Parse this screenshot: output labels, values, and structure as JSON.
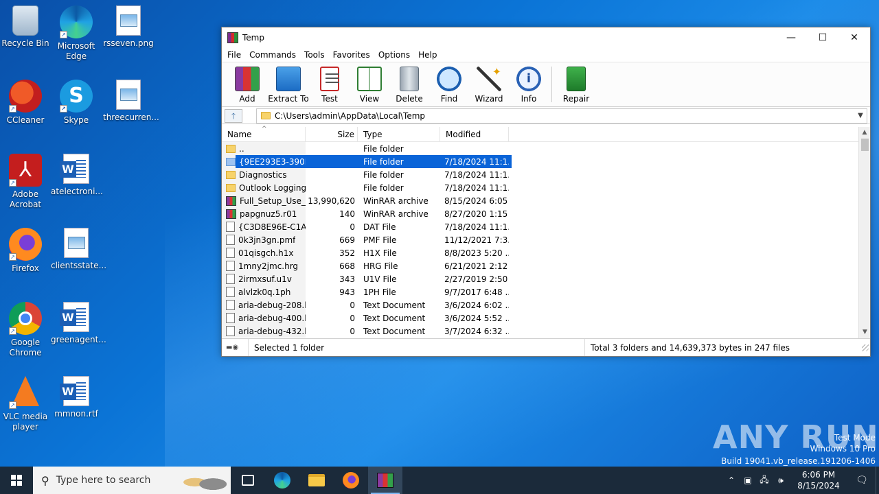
{
  "desktop": {
    "icons": [
      {
        "label": "Recycle Bin"
      },
      {
        "label": "Microsoft Edge"
      },
      {
        "label": "rsseven.png"
      },
      {
        "label": "CCleaner"
      },
      {
        "label": "Skype"
      },
      {
        "label": "threecurren..."
      },
      {
        "label": "Adobe Acrobat"
      },
      {
        "label": "atelectroni..."
      },
      {
        "label": "Firefox"
      },
      {
        "label": "clientsstate..."
      },
      {
        "label": "Google Chrome"
      },
      {
        "label": "greenagent..."
      },
      {
        "label": "VLC media player"
      },
      {
        "label": "mmnon.rtf"
      }
    ]
  },
  "window": {
    "title": "Temp",
    "controls": {
      "minimize": "—",
      "maximize": "☐",
      "close": "✕"
    },
    "menu": [
      "File",
      "Commands",
      "Tools",
      "Favorites",
      "Options",
      "Help"
    ],
    "toolbar": [
      {
        "label": "Add",
        "icon": "add-archive-icon"
      },
      {
        "label": "Extract To",
        "icon": "extract-icon"
      },
      {
        "label": "Test",
        "icon": "test-icon"
      },
      {
        "label": "View",
        "icon": "view-book-icon"
      },
      {
        "label": "Delete",
        "icon": "trash-icon"
      },
      {
        "label": "Find",
        "icon": "magnifier-icon"
      },
      {
        "label": "Wizard",
        "icon": "wand-icon"
      },
      {
        "label": "Info",
        "icon": "info-icon"
      },
      {
        "label": "Repair",
        "icon": "repair-icon"
      }
    ],
    "address": "C:\\Users\\admin\\AppData\\Local\\Temp",
    "columns": {
      "name": "Name",
      "size": "Size",
      "type": "Type",
      "modified": "Modified"
    },
    "files": [
      {
        "name": "..",
        "size": "",
        "type": "File folder",
        "modified": "",
        "icon": "folder"
      },
      {
        "name": "{9EE293E3-390D...",
        "size": "",
        "type": "File folder",
        "modified": "7/18/2024 11:1...",
        "icon": "folder",
        "selected": true
      },
      {
        "name": "Diagnostics",
        "size": "",
        "type": "File folder",
        "modified": "7/18/2024 11:1...",
        "icon": "folder"
      },
      {
        "name": "Outlook Logging",
        "size": "",
        "type": "File folder",
        "modified": "7/18/2024 11:1...",
        "icon": "folder"
      },
      {
        "name": "Full_Setup_Use_...",
        "size": "13,990,620",
        "type": "WinRAR archive",
        "modified": "8/15/2024 6:05 ...",
        "icon": "rar"
      },
      {
        "name": "papgnuz5.r01",
        "size": "140",
        "type": "WinRAR archive",
        "modified": "8/27/2020 1:15 ...",
        "icon": "rar"
      },
      {
        "name": "{C3D8E96E-C1A...",
        "size": "0",
        "type": "DAT File",
        "modified": "7/18/2024 11:1...",
        "icon": "file"
      },
      {
        "name": "0k3jn3gn.pmf",
        "size": "669",
        "type": "PMF File",
        "modified": "11/12/2021 7:3...",
        "icon": "file"
      },
      {
        "name": "01qisgch.h1x",
        "size": "352",
        "type": "H1X File",
        "modified": "8/8/2023 5:20 ...",
        "icon": "file"
      },
      {
        "name": "1mny2jmc.hrg",
        "size": "668",
        "type": "HRG File",
        "modified": "6/21/2021 2:12 ...",
        "icon": "file"
      },
      {
        "name": "2irmxsuf.u1v",
        "size": "343",
        "type": "U1V File",
        "modified": "2/27/2019 2:50 ...",
        "icon": "file"
      },
      {
        "name": "alvlzk0q.1ph",
        "size": "943",
        "type": "1PH File",
        "modified": "9/7/2017 6:48 ...",
        "icon": "file"
      },
      {
        "name": "aria-debug-208.l...",
        "size": "0",
        "type": "Text Document",
        "modified": "3/6/2024 6:02 ...",
        "icon": "file"
      },
      {
        "name": "aria-debug-400.l...",
        "size": "0",
        "type": "Text Document",
        "modified": "3/6/2024 5:52 ...",
        "icon": "file"
      },
      {
        "name": "aria-debug-432.l...",
        "size": "0",
        "type": "Text Document",
        "modified": "3/7/2024 6:32 ...",
        "icon": "file"
      }
    ],
    "status": {
      "left": "Selected 1 folder",
      "right": "Total 3 folders and 14,639,373 bytes in 247 files"
    }
  },
  "watermark": {
    "logo": "ANY RUN",
    "lines": [
      "Test Mode",
      "Windows 10 Pro",
      "Build 19041.vb_release.191206-1406"
    ]
  },
  "taskbar": {
    "search_placeholder": "Type here to search",
    "time": "6:06 PM",
    "date": "8/15/2024"
  }
}
